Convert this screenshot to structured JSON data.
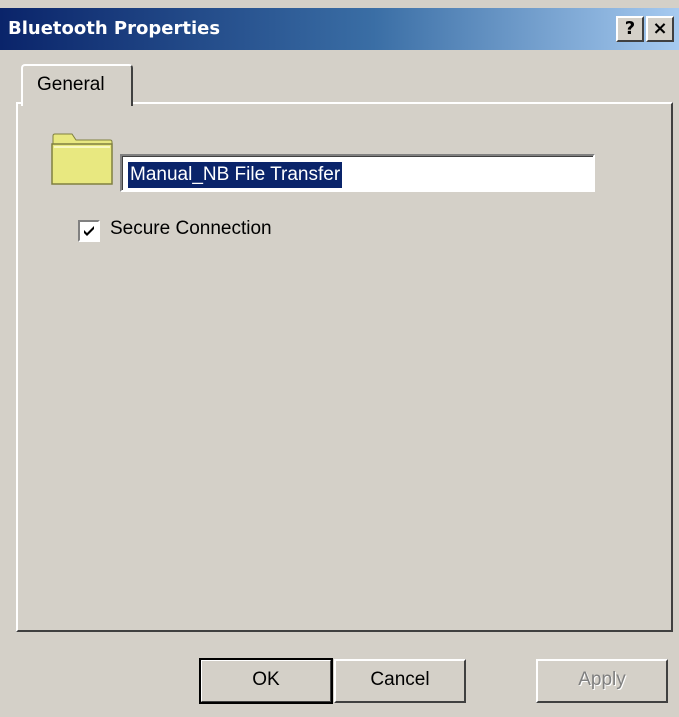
{
  "window": {
    "title": "Bluetooth Properties",
    "help_label": "?",
    "close_label": "×"
  },
  "tabs": [
    {
      "label": "General",
      "selected": true
    }
  ],
  "general": {
    "icon": "folder-icon",
    "name_value": "Manual_NB File Transfer",
    "secure_connection": {
      "label": "Secure Connection",
      "checked": true
    }
  },
  "buttons": {
    "ok": "OK",
    "cancel": "Cancel",
    "apply": "Apply",
    "apply_enabled": false
  },
  "colors": {
    "title_gradient_start": "#0a246a",
    "title_gradient_end": "#a6caf0",
    "face": "#d4d0c8",
    "selection": "#0a246a",
    "folder": "#e8e880"
  }
}
